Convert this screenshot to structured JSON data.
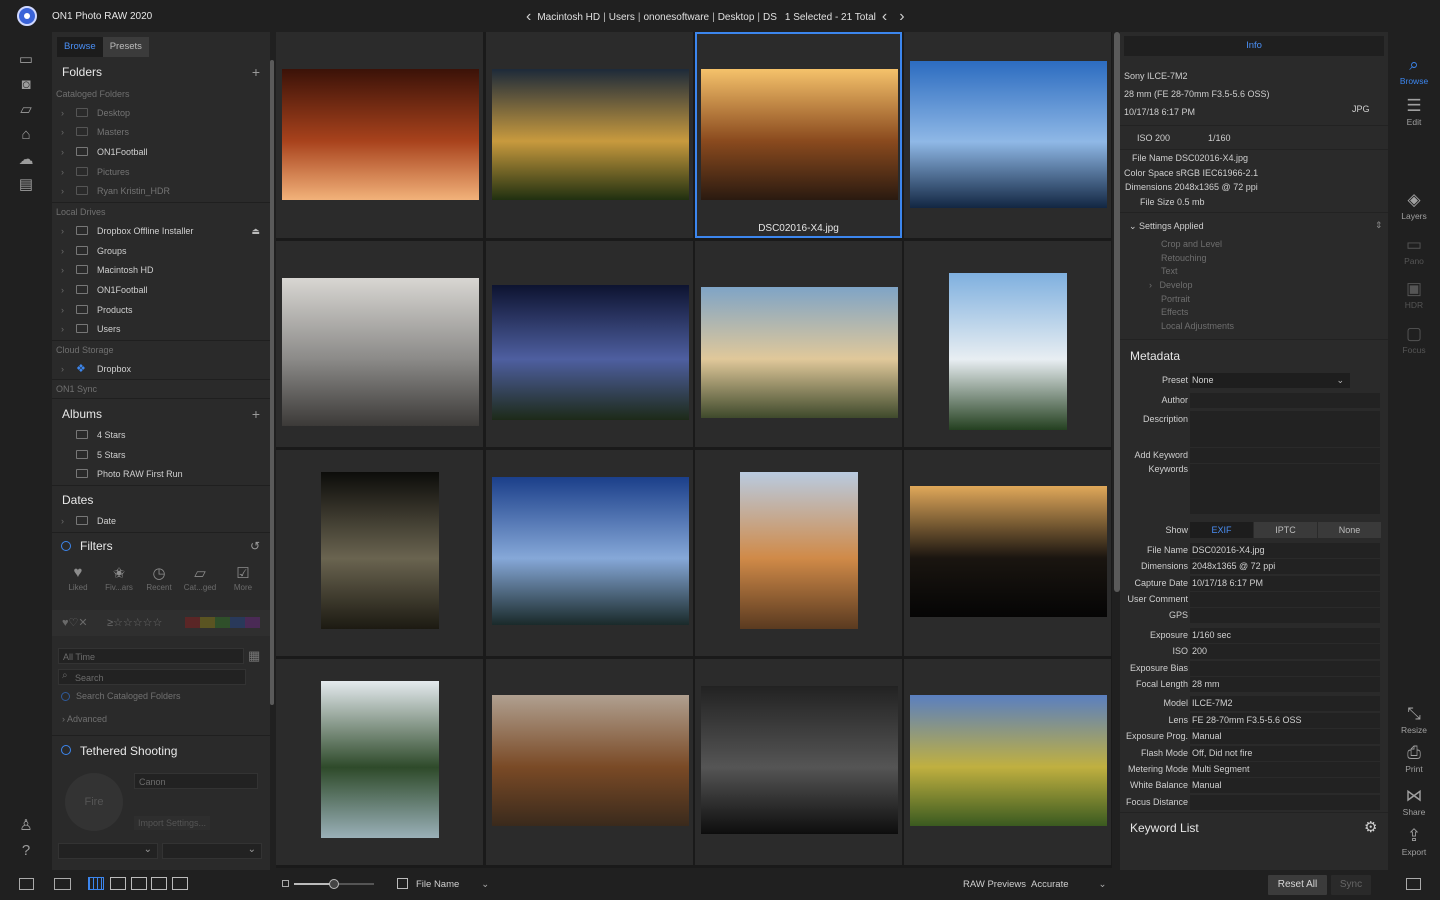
{
  "app": {
    "title": "ON1 Photo RAW 2020",
    "breadcrumb": [
      "Macintosh HD",
      "Users",
      "ononesoftware",
      "Desktop",
      "DS"
    ],
    "selection_status": "1 Selected - 21 Total",
    "accent_color": "#3c86ee"
  },
  "left_strip": {
    "icons": [
      "monitor-icon",
      "camera-icon",
      "folder-icon",
      "drive-icon",
      "cloud-icon",
      "albums-icon",
      "user-icon",
      "help-icon",
      "panel-toggle-icon"
    ]
  },
  "left_panel": {
    "tabs": [
      "Browse",
      "Presets"
    ],
    "folders": {
      "title": "Folders",
      "cataloged_label": "Cataloged Folders",
      "cataloged_items": [
        "Desktop",
        "Masters",
        "ON1Football",
        "Pictures",
        "Ryan Kristin_HDR"
      ],
      "local_drives_label": "Local Drives",
      "local_drives": [
        "Dropbox Offline Installer",
        "Groups",
        "Macintosh HD",
        "ON1Football",
        "Products",
        "Users"
      ],
      "cloud_label": "Cloud Storage",
      "cloud_items": [
        "Dropbox"
      ],
      "sync_label": "ON1 Sync"
    },
    "albums": {
      "title": "Albums",
      "items": [
        "4 Stars",
        "5 Stars",
        "Photo RAW First Run"
      ]
    },
    "dates": {
      "title": "Dates",
      "items": [
        "Date"
      ]
    },
    "filters": {
      "title": "Filters",
      "buttons": [
        "Liked",
        "Fiv...ars",
        "Recent",
        "Cat...ged",
        "More"
      ],
      "time_range": "All Time",
      "search_placeholder": "Search",
      "search_scope": "Search Cataloged Folders",
      "advanced": "Advanced"
    },
    "tethered": {
      "title": "Tethered Shooting",
      "camera": "Canon",
      "fire": "Fire",
      "import_settings": "Import Settings..."
    }
  },
  "grid": {
    "selected_index": 2,
    "selected_filename": "DSC02016-X4.jpg",
    "photos": [
      {
        "subject": "canyon",
        "colors": [
          "#3b1208",
          "#a8421c",
          "#f2b27a"
        ]
      },
      {
        "subject": "tulips",
        "colors": [
          "#1d2a3a",
          "#c89a3e",
          "#203010"
        ]
      },
      {
        "subject": "mountain-sunset",
        "colors": [
          "#f5c26b",
          "#8a4a1e",
          "#2a1a10"
        ]
      },
      {
        "subject": "hiker-reflection",
        "colors": [
          "#2c6cc0",
          "#8fb8e6",
          "#122642"
        ]
      },
      {
        "subject": "misty-peak",
        "colors": [
          "#d8d6d2",
          "#8b8a88",
          "#3c3a38"
        ]
      },
      {
        "subject": "milky-way-motorbike",
        "colors": [
          "#0d1330",
          "#4e5fa0",
          "#1d2a18"
        ]
      },
      {
        "subject": "lake-sunset",
        "colors": [
          "#7fa4c6",
          "#e0c89a",
          "#3f4a2c"
        ]
      },
      {
        "subject": "lake-forest",
        "colors": [
          "#7fb0df",
          "#e8eef2",
          "#244020"
        ]
      },
      {
        "subject": "forest-cyclist",
        "colors": [
          "#0c0c0a",
          "#6a6450",
          "#1c1a12"
        ]
      },
      {
        "subject": "mountain-lake-stars",
        "colors": [
          "#1b3f8a",
          "#86a8d8",
          "#1a2a2a"
        ]
      },
      {
        "subject": "lighthouse",
        "colors": [
          "#b9cbe0",
          "#d08a48",
          "#5a3a20"
        ]
      },
      {
        "subject": "tree-silhouette",
        "colors": [
          "#e0a85a",
          "#1a1510",
          "#050505"
        ]
      },
      {
        "subject": "waterfall",
        "colors": [
          "#e4eaee",
          "#2e4a2a",
          "#9ab0b8"
        ]
      },
      {
        "subject": "autumn-fog",
        "colors": [
          "#b0a090",
          "#7a4a26",
          "#3a2a1c"
        ]
      },
      {
        "subject": "dark-forest",
        "colors": [
          "#222222",
          "#555555",
          "#0d0d0d"
        ]
      },
      {
        "subject": "wildflower-hill",
        "colors": [
          "#5a7fc0",
          "#c0b040",
          "#3a5a20"
        ]
      }
    ]
  },
  "info_panel": {
    "header": "Info",
    "camera": "Sony ILCE-7M2",
    "lens": "28 mm (FE 28-70mm F3.5-5.6 OSS)",
    "datetime": "10/17/18 6:17 PM",
    "format": "JPG",
    "iso": "ISO 200",
    "shutter": "1/160",
    "file_name": "File Name DSC02016-X4.jpg",
    "color_space": "Color Space sRGB IEC61966-2.1",
    "dimensions": "Dimensions 2048x1365 @ 72 ppi",
    "file_size": "File Size 0.5 mb",
    "settings_title": "Settings Applied",
    "settings_items": [
      "Crop and Level",
      "Retouching",
      "Text",
      "Develop",
      "Portrait",
      "Effects",
      "Local Adjustments"
    ]
  },
  "metadata": {
    "title": "Metadata",
    "preset_label": "Preset",
    "preset_value": "None",
    "author_label": "Author",
    "description_label": "Description",
    "add_keyword_label": "Add Keyword",
    "keywords_label": "Keywords",
    "show_label": "Show",
    "show_options": [
      "EXIF",
      "IPTC",
      "None"
    ],
    "show_active": "EXIF",
    "exif": [
      {
        "label": "File Name",
        "value": "DSC02016-X4.jpg"
      },
      {
        "label": "Dimensions",
        "value": "2048x1365 @ 72 ppi"
      },
      {
        "label": "Capture Date",
        "value": "10/17/18 6:17 PM"
      },
      {
        "label": "User Comment",
        "value": ""
      },
      {
        "label": "GPS",
        "value": ""
      },
      {
        "label": "Exposure",
        "value": "1/160 sec"
      },
      {
        "label": "ISO",
        "value": "200"
      },
      {
        "label": "Exposure Bias",
        "value": ""
      },
      {
        "label": "Focal Length",
        "value": "28 mm"
      },
      {
        "label": "Model",
        "value": "ILCE-7M2"
      },
      {
        "label": "Lens",
        "value": "FE 28-70mm F3.5-5.6 OSS"
      },
      {
        "label": "Exposure Prog.",
        "value": "Manual"
      },
      {
        "label": "Flash Mode",
        "value": "Off, Did not fire"
      },
      {
        "label": "Metering Mode",
        "value": "Multi Segment"
      },
      {
        "label": "White Balance",
        "value": "Manual"
      },
      {
        "label": "Focus Distance",
        "value": ""
      }
    ],
    "keyword_list_title": "Keyword List"
  },
  "right_strip": {
    "modules": [
      {
        "label": "Browse",
        "icon": "browse-icon",
        "active": true
      },
      {
        "label": "Edit",
        "icon": "sliders-icon",
        "active": false
      },
      {
        "label": "Layers",
        "icon": "layers-icon",
        "active": false
      },
      {
        "label": "Pano",
        "icon": "pano-icon",
        "active": false
      },
      {
        "label": "HDR",
        "icon": "hdr-icon",
        "active": false
      },
      {
        "label": "Focus",
        "icon": "focus-icon",
        "active": false
      }
    ],
    "actions": [
      {
        "label": "Resize",
        "icon": "resize-icon"
      },
      {
        "label": "Print",
        "icon": "print-icon"
      },
      {
        "label": "Share",
        "icon": "share-icon"
      },
      {
        "label": "Export",
        "icon": "export-icon"
      }
    ]
  },
  "bottom_bar": {
    "thumbnail_size": 0.5,
    "sort_by": "File Name",
    "raw_previews_label": "RAW Previews",
    "raw_previews_value": "Accurate",
    "reset_all": "Reset All",
    "sync": "Sync"
  }
}
